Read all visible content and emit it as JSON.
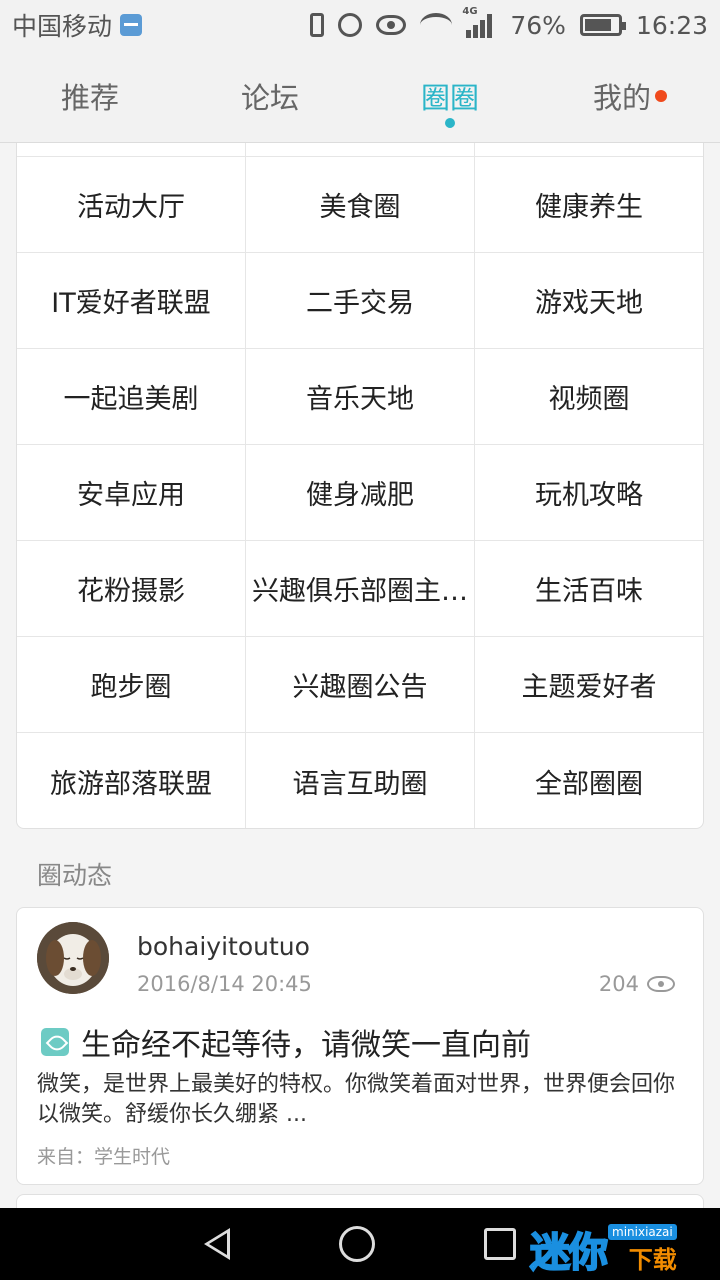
{
  "status_bar": {
    "carrier": "中国移动",
    "network": "4G",
    "battery": "76%",
    "time": "16:23"
  },
  "tabs": [
    {
      "label": "推荐"
    },
    {
      "label": "论坛"
    },
    {
      "label": "圈圈",
      "active": true
    },
    {
      "label": "我的",
      "badge_dot": true
    }
  ],
  "circles": [
    [
      "活动大厅",
      "美食圈",
      "健康养生"
    ],
    [
      "IT爱好者联盟",
      "二手交易",
      "游戏天地"
    ],
    [
      "一起追美剧",
      "音乐天地",
      "视频圈"
    ],
    [
      "安卓应用",
      "健身减肥",
      "玩机攻略"
    ],
    [
      "花粉摄影",
      "兴趣俱乐部圈主…",
      "生活百味"
    ],
    [
      "跑步圈",
      "兴趣圈公告",
      "主题爱好者"
    ],
    [
      "旅游部落联盟",
      "语言互助圈",
      "全部圈圈"
    ]
  ],
  "feed": {
    "section_title": "圈动态",
    "post": {
      "author": "bohaiyitoutuo",
      "time": "2016/8/14 20:45",
      "views": "204",
      "title": "生命经不起等待，请微笑一直向前",
      "excerpt": "微笑，是世界上最美好的特权。你微笑着面对世界，世界便会回你以微笑。舒缓你长久绷紧 ...",
      "source": "来自：学生时代"
    }
  },
  "watermark": {
    "main": "迷你",
    "top": "minixiazai",
    "bottom": "下载"
  },
  "colors": {
    "accent": "#2bb5c8",
    "badge": "#f04a1c"
  }
}
